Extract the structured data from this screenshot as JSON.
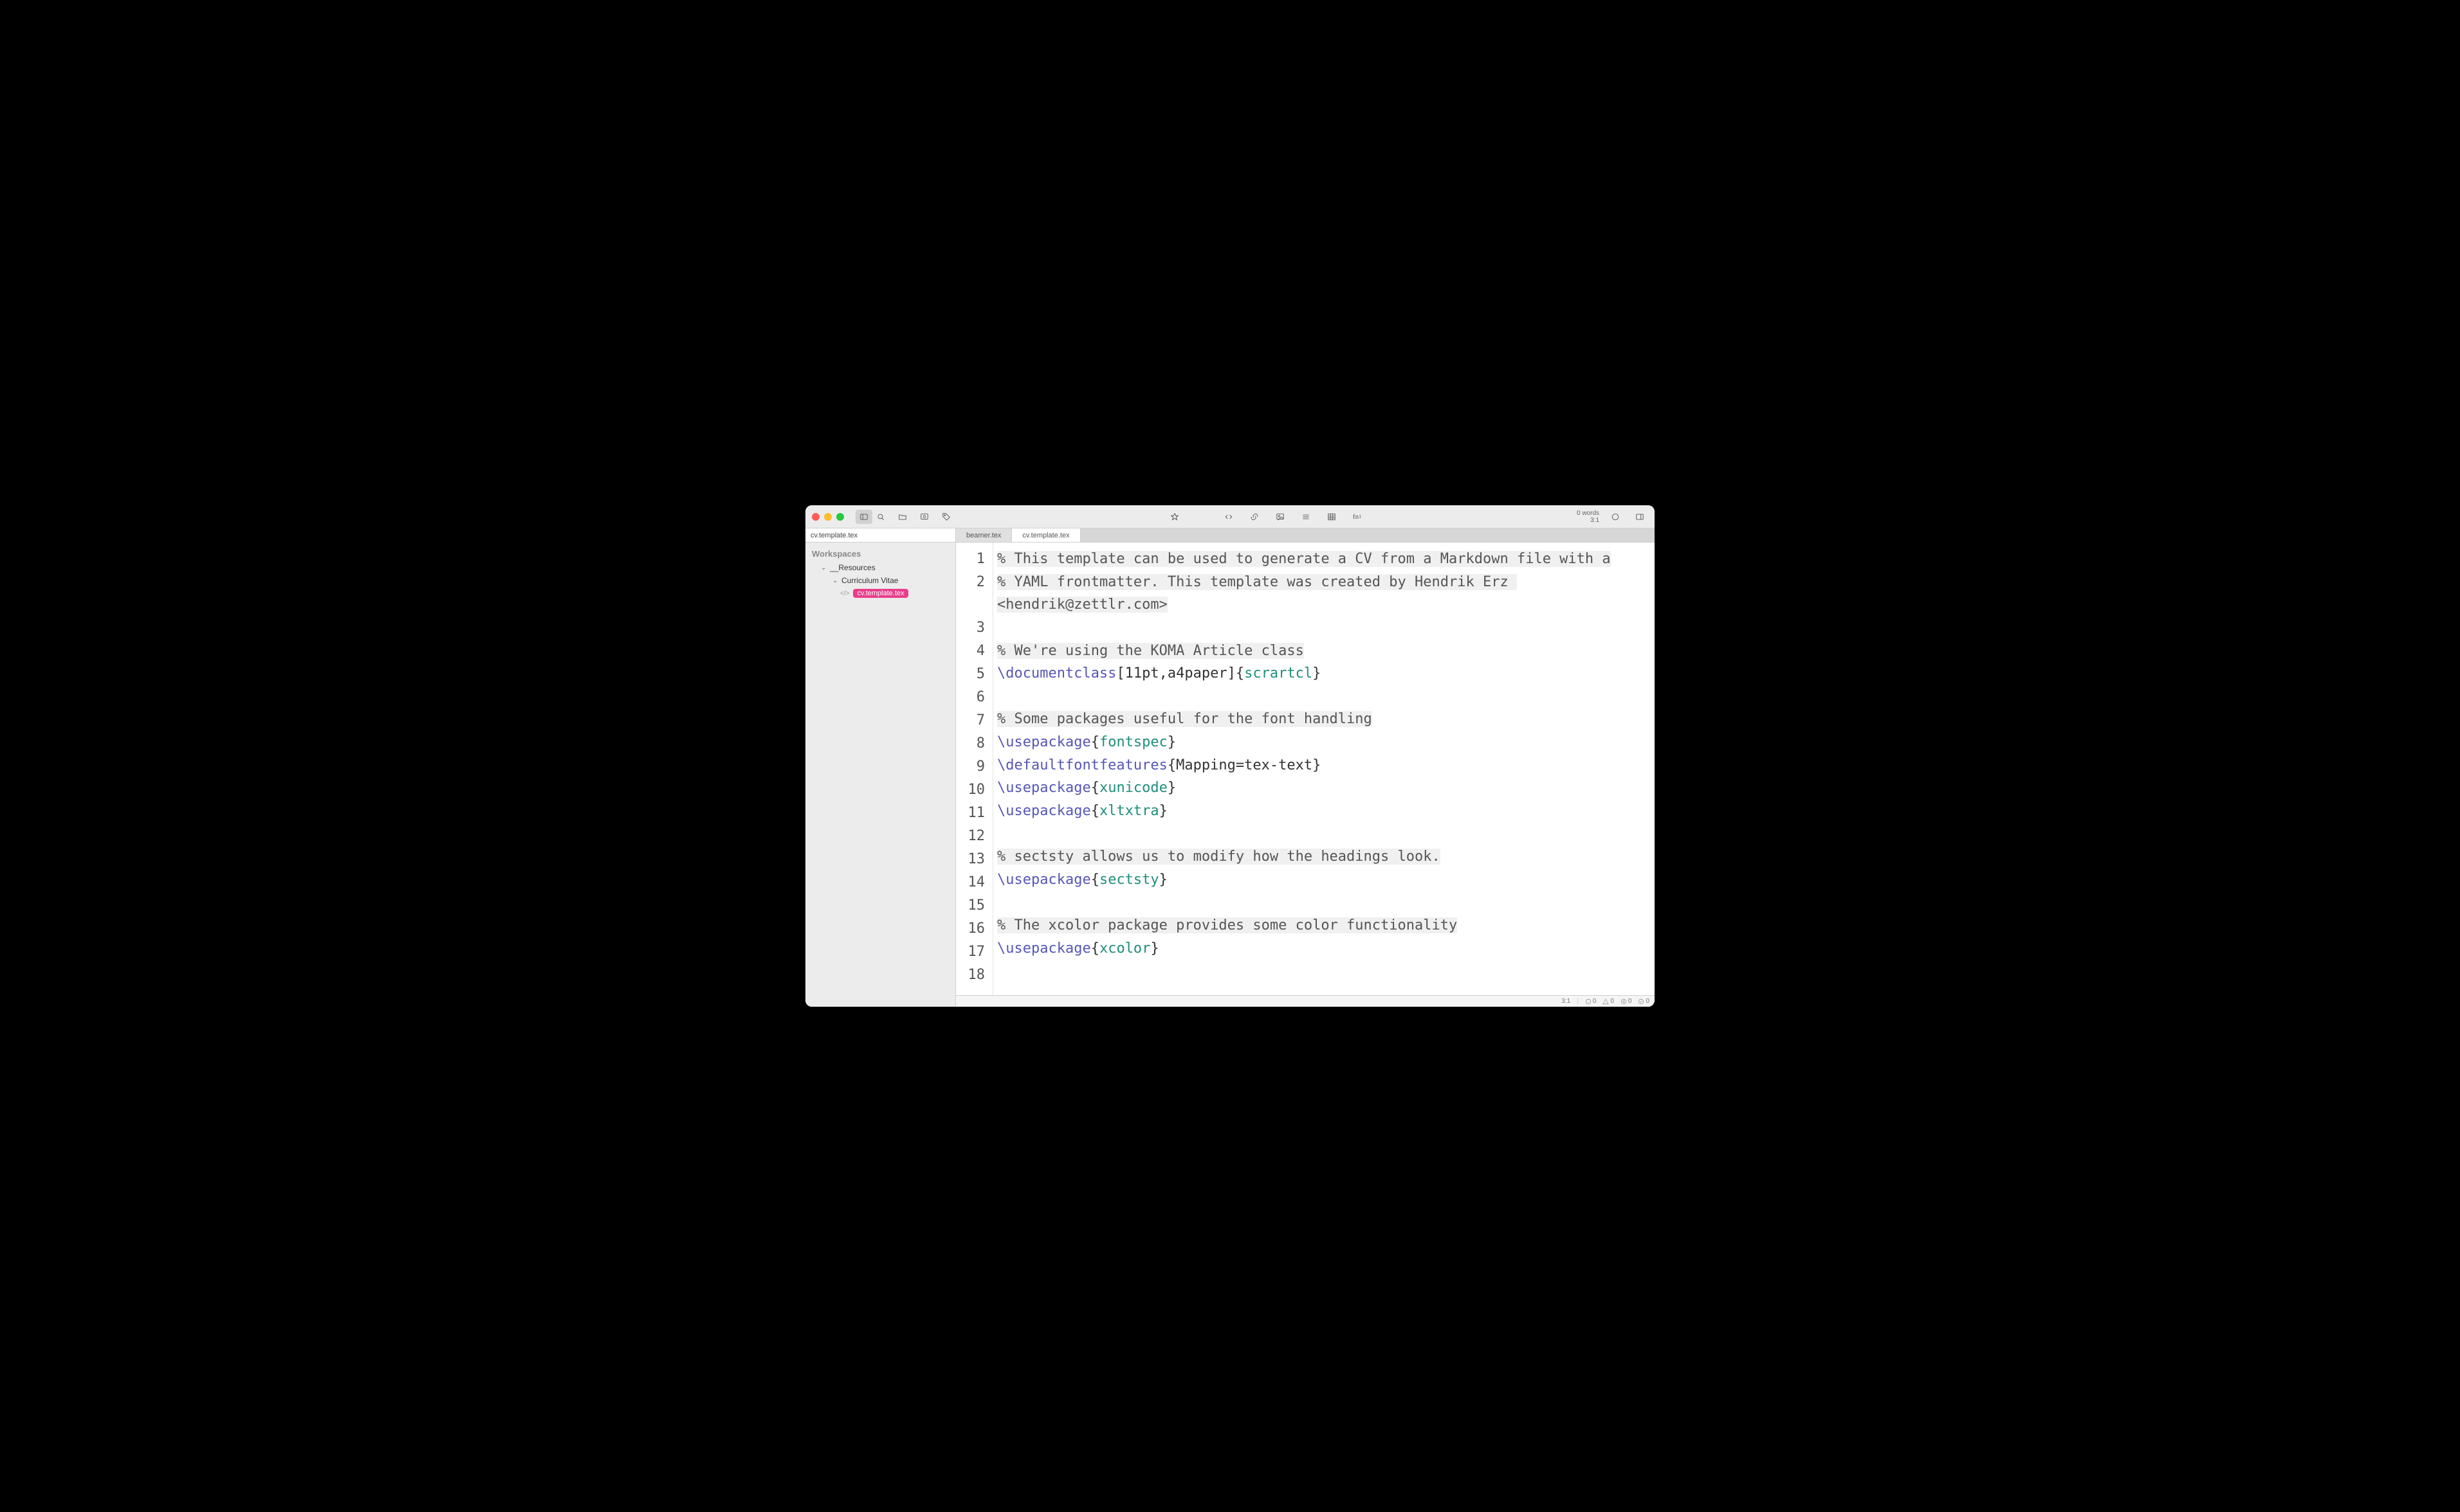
{
  "toolbar": {
    "wordcount_words": "0 words",
    "wordcount_cursor": "3:1"
  },
  "breadcrumb": "cv.template.tex",
  "sidebar": {
    "heading": "Workspaces",
    "items": [
      {
        "label": "__Resources",
        "type": "folder",
        "expanded": true,
        "indent": 1
      },
      {
        "label": "Curriculum Vitae",
        "type": "folder",
        "expanded": true,
        "indent": 2
      },
      {
        "label": "cv.template.tex",
        "type": "file",
        "active": true,
        "indent": 3
      }
    ]
  },
  "tabs": [
    {
      "label": "beamer.tex",
      "active": false
    },
    {
      "label": "cv.template.tex",
      "active": true
    }
  ],
  "code": {
    "lines": [
      {
        "n": 1,
        "tokens": [
          {
            "t": "comment",
            "v": "% This template can be used to generate a CV from a Markdown file with a"
          }
        ]
      },
      {
        "n": 2,
        "tokens": [
          {
            "t": "comment",
            "v": "% YAML frontmatter. This template was created by Hendrik Erz <hendrik@zettlr.com>"
          }
        ]
      },
      {
        "n": 3,
        "tokens": []
      },
      {
        "n": 4,
        "tokens": [
          {
            "t": "comment",
            "v": "% We're using the KOMA Article class"
          }
        ]
      },
      {
        "n": 5,
        "tokens": [
          {
            "t": "cmd",
            "v": "\\documentclass"
          },
          {
            "t": "plain",
            "v": "[11pt,a4paper]{"
          },
          {
            "t": "arg",
            "v": "scrartcl"
          },
          {
            "t": "plain",
            "v": "}"
          }
        ]
      },
      {
        "n": 6,
        "tokens": []
      },
      {
        "n": 7,
        "tokens": [
          {
            "t": "comment",
            "v": "% Some packages useful for the font handling"
          }
        ]
      },
      {
        "n": 8,
        "tokens": [
          {
            "t": "cmd",
            "v": "\\usepackage"
          },
          {
            "t": "plain",
            "v": "{"
          },
          {
            "t": "arg",
            "v": "fontspec"
          },
          {
            "t": "plain",
            "v": "}"
          }
        ]
      },
      {
        "n": 9,
        "tokens": [
          {
            "t": "cmd",
            "v": "\\defaultfontfeatures"
          },
          {
            "t": "plain",
            "v": "{Mapping=tex-text}"
          }
        ]
      },
      {
        "n": 10,
        "tokens": [
          {
            "t": "cmd",
            "v": "\\usepackage"
          },
          {
            "t": "plain",
            "v": "{"
          },
          {
            "t": "arg",
            "v": "xunicode"
          },
          {
            "t": "plain",
            "v": "}"
          }
        ]
      },
      {
        "n": 11,
        "tokens": [
          {
            "t": "cmd",
            "v": "\\usepackage"
          },
          {
            "t": "plain",
            "v": "{"
          },
          {
            "t": "arg",
            "v": "xltxtra"
          },
          {
            "t": "plain",
            "v": "}"
          }
        ]
      },
      {
        "n": 12,
        "tokens": []
      },
      {
        "n": 13,
        "tokens": [
          {
            "t": "comment",
            "v": "% sectsty allows us to modify how the headings look."
          }
        ]
      },
      {
        "n": 14,
        "tokens": [
          {
            "t": "cmd",
            "v": "\\usepackage"
          },
          {
            "t": "plain",
            "v": "{"
          },
          {
            "t": "arg",
            "v": "sectsty"
          },
          {
            "t": "plain",
            "v": "}"
          }
        ]
      },
      {
        "n": 15,
        "tokens": []
      },
      {
        "n": 16,
        "tokens": [
          {
            "t": "comment",
            "v": "% The xcolor package provides some color functionality"
          }
        ]
      },
      {
        "n": 17,
        "tokens": [
          {
            "t": "cmd",
            "v": "\\usepackage"
          },
          {
            "t": "plain",
            "v": "{"
          },
          {
            "t": "arg",
            "v": "xcolor"
          },
          {
            "t": "plain",
            "v": "}"
          }
        ]
      },
      {
        "n": 18,
        "tokens": []
      }
    ]
  },
  "statusbar": {
    "cursor": "3:1",
    "counts": {
      "info": "0",
      "warn": "0",
      "error": "0",
      "ok": "0"
    }
  }
}
